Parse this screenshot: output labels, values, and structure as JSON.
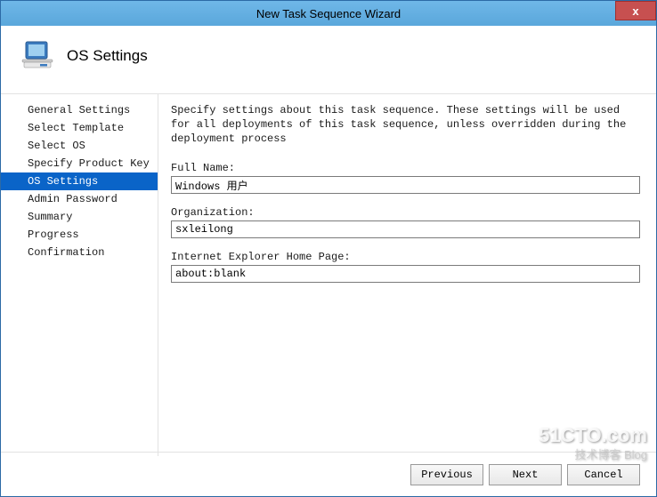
{
  "window": {
    "title": "New Task Sequence Wizard",
    "close_label": "x"
  },
  "header": {
    "title": "OS Settings"
  },
  "sidebar": {
    "items": [
      {
        "label": "General Settings"
      },
      {
        "label": "Select Template"
      },
      {
        "label": "Select OS"
      },
      {
        "label": "Specify Product Key"
      },
      {
        "label": "OS Settings"
      },
      {
        "label": "Admin Password"
      },
      {
        "label": "Summary"
      },
      {
        "label": "Progress"
      },
      {
        "label": "Confirmation"
      }
    ],
    "selected_index": 4
  },
  "main": {
    "description": "Specify settings about this task sequence.  These settings will be used for all deployments of this task sequence, unless overridden during the deployment process",
    "full_name_label": "Full Name:",
    "full_name_value": "Windows 用户",
    "organization_label": "Organization:",
    "organization_value": "sxleilong",
    "homepage_label": "Internet Explorer Home Page:",
    "homepage_value": "about:blank"
  },
  "footer": {
    "previous": "Previous",
    "next": "Next",
    "cancel": "Cancel"
  },
  "watermark": {
    "main": "51CTO.com",
    "sub": "技术博客  Blog"
  }
}
